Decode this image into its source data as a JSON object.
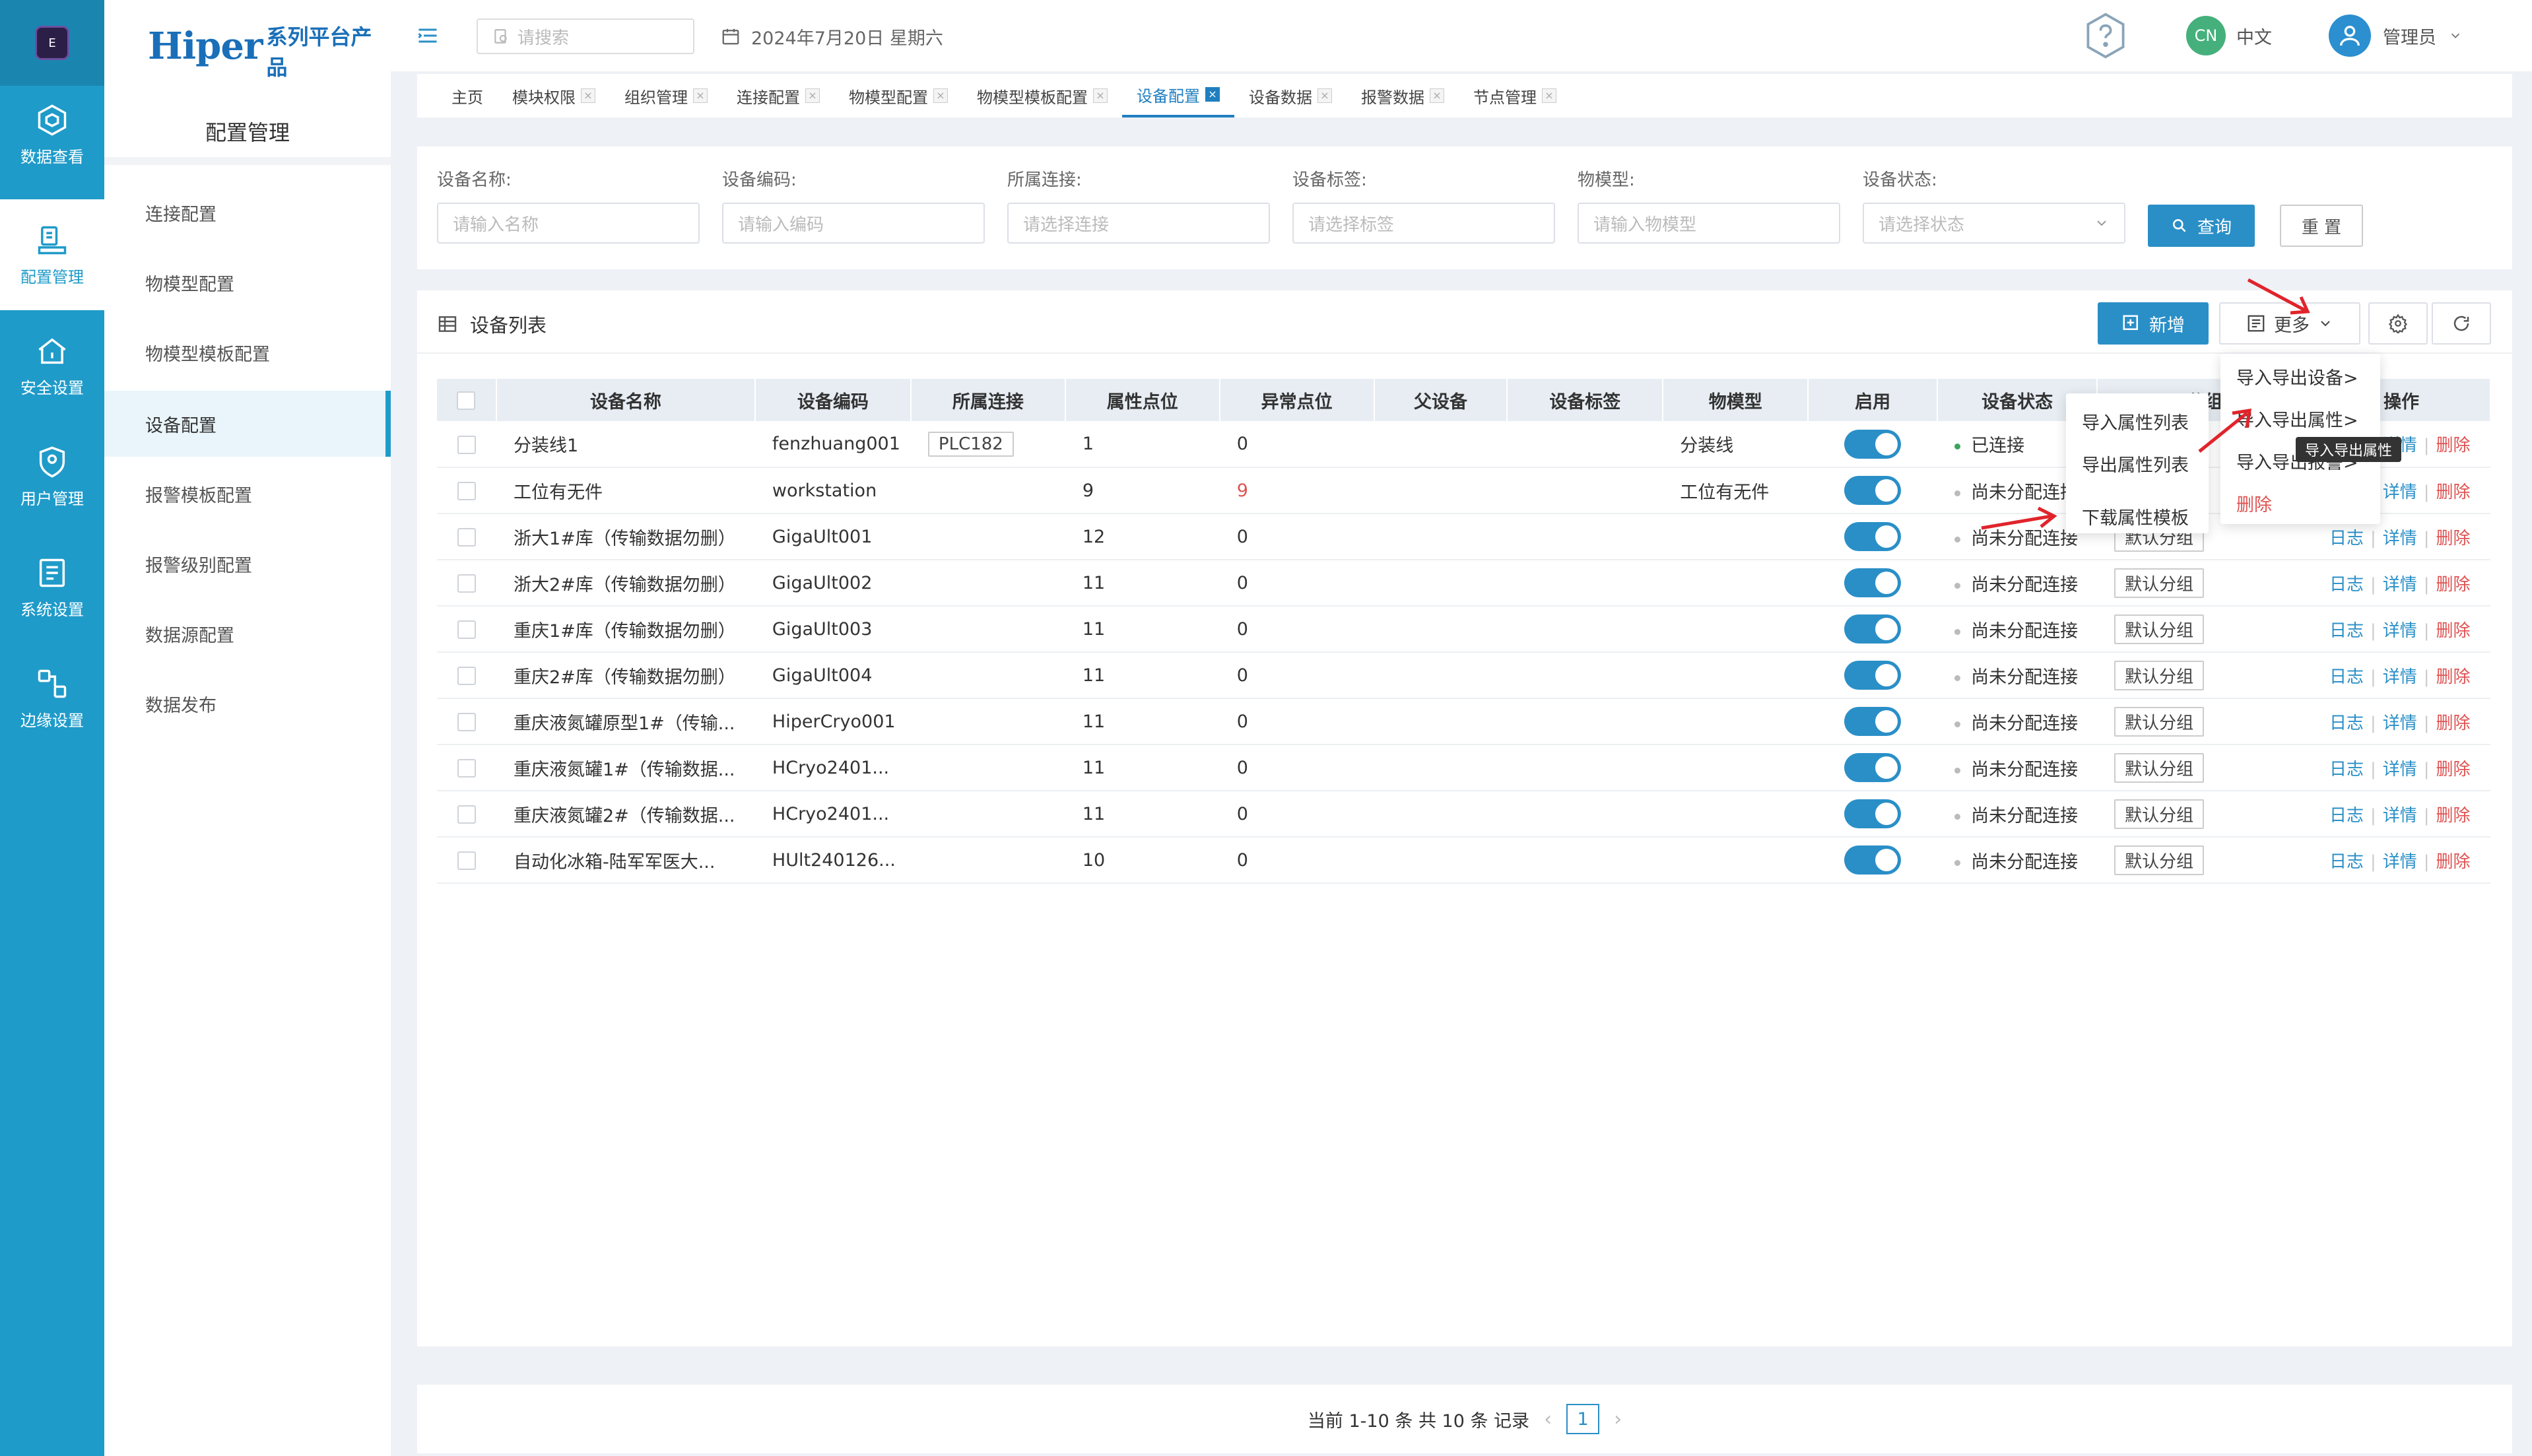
{
  "rail": {
    "items": [
      {
        "label": "数据查看",
        "icon": "data-view-icon"
      },
      {
        "label": "配置管理",
        "icon": "config-manage-icon"
      },
      {
        "label": "安全设置",
        "icon": "security-icon"
      },
      {
        "label": "用户管理",
        "icon": "user-manage-icon"
      },
      {
        "label": "系统设置",
        "icon": "system-settings-icon"
      },
      {
        "label": "边缘设置",
        "icon": "edge-settings-icon"
      }
    ]
  },
  "brand": {
    "name": "Hiper",
    "suffix": "系列平台产品"
  },
  "sidebar": {
    "title": "配置管理",
    "items": [
      {
        "label": "连接配置"
      },
      {
        "label": "物模型配置"
      },
      {
        "label": "物模型模板配置"
      },
      {
        "label": "设备配置"
      },
      {
        "label": "报警模板配置"
      },
      {
        "label": "报警级别配置"
      },
      {
        "label": "数据源配置"
      },
      {
        "label": "数据发布"
      }
    ]
  },
  "header": {
    "search_placeholder": "请搜索",
    "date": "2024年7月20日 星期六",
    "lang_badge": "CN",
    "lang": "中文",
    "user": "管理员"
  },
  "tabs": [
    {
      "label": "主页"
    },
    {
      "label": "模块权限"
    },
    {
      "label": "组织管理"
    },
    {
      "label": "连接配置"
    },
    {
      "label": "物模型配置"
    },
    {
      "label": "物模型模板配置"
    },
    {
      "label": "设备配置"
    },
    {
      "label": "设备数据"
    },
    {
      "label": "报警数据"
    },
    {
      "label": "节点管理"
    }
  ],
  "filters": [
    {
      "label": "设备名称:",
      "placeholder": "请输入名称"
    },
    {
      "label": "设备编码:",
      "placeholder": "请输入编码"
    },
    {
      "label": "所属连接:",
      "placeholder": "请选择连接"
    },
    {
      "label": "设备标签:",
      "placeholder": "请选择标签"
    },
    {
      "label": "物模型:",
      "placeholder": "请输入物模型"
    },
    {
      "label": "设备状态:",
      "placeholder": "请选择状态"
    }
  ],
  "buttons": {
    "query": "查询",
    "reset": "重 置",
    "add": "新增",
    "more": "更多"
  },
  "list": {
    "title": "设备列表",
    "columns": [
      "设备名称",
      "设备编码",
      "所属连接",
      "属性点位",
      "异常点位",
      "父设备",
      "设备标签",
      "物模型",
      "启用",
      "设备状态",
      "分组",
      "操作"
    ],
    "rows": [
      {
        "name": "分装线1",
        "code": "fenzhuang001",
        "conn": "PLC182",
        "attr": "1",
        "abn": "0",
        "abn_red": false,
        "model": "分装线",
        "status": "已连接",
        "connected": true,
        "group": ""
      },
      {
        "name": "工位有无件",
        "code": "workstation",
        "conn": "",
        "attr": "9",
        "abn": "9",
        "abn_red": true,
        "model": "工位有无件",
        "status": "尚未分配连接",
        "connected": false,
        "group": ""
      },
      {
        "name": "浙大1#库（传输数据勿删）",
        "code": "GigaUlt001",
        "conn": "",
        "attr": "12",
        "abn": "0",
        "abn_red": false,
        "model": "",
        "status": "尚未分配连接",
        "connected": false,
        "group": "默认分组"
      },
      {
        "name": "浙大2#库（传输数据勿删）",
        "code": "GigaUlt002",
        "conn": "",
        "attr": "11",
        "abn": "0",
        "abn_red": false,
        "model": "",
        "status": "尚未分配连接",
        "connected": false,
        "group": "默认分组"
      },
      {
        "name": "重庆1#库（传输数据勿删）",
        "code": "GigaUlt003",
        "conn": "",
        "attr": "11",
        "abn": "0",
        "abn_red": false,
        "model": "",
        "status": "尚未分配连接",
        "connected": false,
        "group": "默认分组"
      },
      {
        "name": "重庆2#库（传输数据勿删）",
        "code": "GigaUlt004",
        "conn": "",
        "attr": "11",
        "abn": "0",
        "abn_red": false,
        "model": "",
        "status": "尚未分配连接",
        "connected": false,
        "group": "默认分组"
      },
      {
        "name": "重庆液氮罐原型1#（传输...",
        "code": "HiperCryo001",
        "conn": "",
        "attr": "11",
        "abn": "0",
        "abn_red": false,
        "model": "",
        "status": "尚未分配连接",
        "connected": false,
        "group": "默认分组"
      },
      {
        "name": "重庆液氮罐1#（传输数据...",
        "code": "HCryo2401...",
        "conn": "",
        "attr": "11",
        "abn": "0",
        "abn_red": false,
        "model": "",
        "status": "尚未分配连接",
        "connected": false,
        "group": "默认分组"
      },
      {
        "name": "重庆液氮罐2#（传输数据...",
        "code": "HCryo2401...",
        "conn": "",
        "attr": "11",
        "abn": "0",
        "abn_red": false,
        "model": "",
        "status": "尚未分配连接",
        "connected": false,
        "group": "默认分组"
      },
      {
        "name": "自动化冰箱-陆军军医大...",
        "code": "HUlt240126...",
        "conn": "",
        "attr": "10",
        "abn": "0",
        "abn_red": false,
        "model": "",
        "status": "尚未分配连接",
        "connected": false,
        "group": "默认分组"
      }
    ],
    "ops": {
      "log": "日志",
      "detail": "详情",
      "delete": "删除"
    }
  },
  "more_menu": {
    "items": [
      "导入导出设备>",
      "导入导出属性>",
      "导入导出报警>",
      "删除"
    ]
  },
  "sub_menu": {
    "items": [
      "导入属性列表",
      "导出属性列表",
      "下载属性模板"
    ]
  },
  "tooltip": "导入导出属性",
  "pager": {
    "summary": "当前 1-10 条 共 10 条 记录",
    "page": "1"
  },
  "colors": {
    "primary": "#2a8fc7",
    "rail": "#1f9bc9",
    "danger": "#e05353",
    "annotation": "#e0242b"
  }
}
